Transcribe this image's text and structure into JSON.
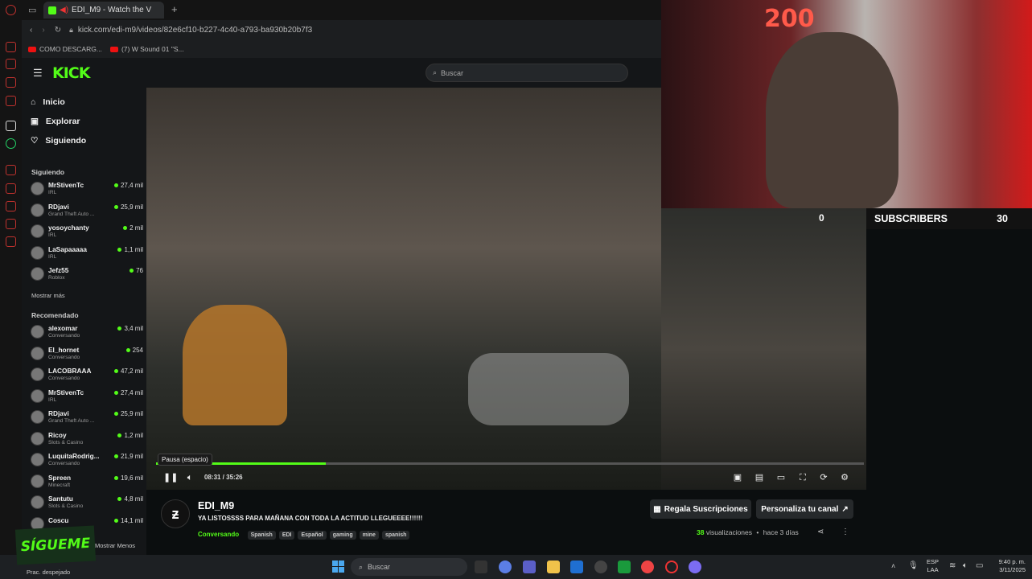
{
  "browser": {
    "tab_title": "EDI_M9 - Watch the V",
    "url": "kick.com/edi-m9/videos/82e6cf10-b227-4c40-a793-ba930b20b7f3",
    "bookmarks": [
      "COMO DESCARG...",
      "(7) W Sound 01 \"S..."
    ]
  },
  "kick": {
    "logo": "KICK",
    "search_placeholder": "Buscar",
    "nav": [
      {
        "label": "Inicio",
        "icon": "home-icon"
      },
      {
        "label": "Explorar",
        "icon": "compass-icon"
      },
      {
        "label": "Siguiendo",
        "icon": "heart-icon"
      }
    ],
    "following_title": "Siguiendo",
    "following": [
      {
        "name": "MrStivenTc",
        "category": "IRL",
        "viewers": "27,4 mil"
      },
      {
        "name": "RDjavi",
        "category": "Grand Theft Auto ...",
        "viewers": "25,9 mil"
      },
      {
        "name": "yosoychanty",
        "category": "IRL",
        "viewers": "2 mil"
      },
      {
        "name": "LaSapaaaaa",
        "category": "IRL",
        "viewers": "1,1 mil"
      },
      {
        "name": "Jefz55",
        "category": "Roblox",
        "viewers": "76"
      }
    ],
    "show_more": "Mostrar más",
    "recommended_title": "Recomendado",
    "recommended": [
      {
        "name": "alexomar",
        "category": "Conversando",
        "viewers": "3,4 mil"
      },
      {
        "name": "El_hornet",
        "category": "Conversando",
        "viewers": "254"
      },
      {
        "name": "LACOBRAAA",
        "category": "Conversando",
        "viewers": "47,2 mil"
      },
      {
        "name": "MrStivenTc",
        "category": "IRL",
        "viewers": "27,4 mil"
      },
      {
        "name": "RDjavi",
        "category": "Grand Theft Auto ...",
        "viewers": "25,9 mil"
      },
      {
        "name": "Ricoy",
        "category": "Slots & Casino",
        "viewers": "1,2 mil"
      },
      {
        "name": "LuquitaRodrig...",
        "category": "Conversando",
        "viewers": "21,9 mil"
      },
      {
        "name": "Spreen",
        "category": "Minecraft",
        "viewers": "19,6 mil"
      },
      {
        "name": "Santutu",
        "category": "Slots & Casino",
        "viewers": "4,8 mil"
      },
      {
        "name": "Coscu",
        "category": "",
        "viewers": "14,1 mil"
      }
    ],
    "show_less": "Mostrar Menos"
  },
  "player": {
    "tooltip": "Pausa (espacio)",
    "time": "08:31 / 35:26",
    "progress": 0.24
  },
  "overlay": {
    "subscribers_label": "SUBSCRIBERS",
    "left_count": "0",
    "right_count": "30",
    "sign": "200"
  },
  "video_info": {
    "channel": "EDI_M9",
    "title": "YA LISTOSSSS PARA MAÑANA CON TODA LA ACTITUD LLEGUEEEE!!!!!!",
    "category": "Conversando",
    "tags": [
      "Spanish",
      "EDI",
      "Español",
      "gaming",
      "mine",
      "spanish"
    ],
    "gift_button": "Regala Suscripciones",
    "customize_button": "Personaliza tu canal",
    "views_count": "38",
    "views_label": "visualizaciones",
    "age": "hace 3 días"
  },
  "sigueme": "SÍGUEME",
  "taskbar": {
    "weather": "Prac. despejado",
    "search": "Buscar",
    "lang1": "ESP",
    "lang2": "LAA",
    "time": "9:40 p. m.",
    "date": "3/11/2025"
  },
  "colors": {
    "accent": "#53fc18",
    "browser_red": "#c0322e"
  }
}
